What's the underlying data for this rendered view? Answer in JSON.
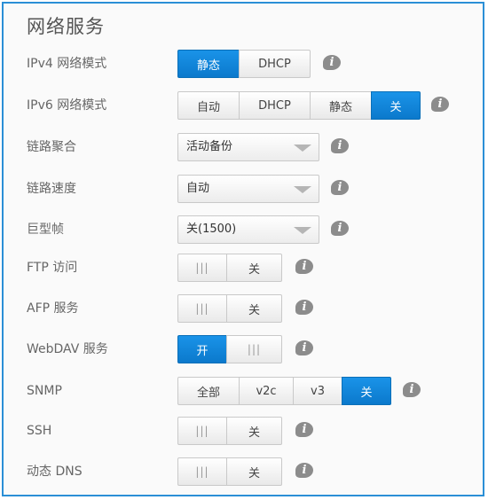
{
  "title": "网络服务",
  "info_icon_glyph": "i",
  "rows": {
    "ipv4": {
      "label": "IPv4 网络模式",
      "opt0": "静态",
      "opt1": "DHCP"
    },
    "ipv6": {
      "label": "IPv6 网络模式",
      "opt0": "自动",
      "opt1": "DHCP",
      "opt2": "静态",
      "opt3": "关"
    },
    "link_agg": {
      "label": "链路聚合",
      "value": "活动备份"
    },
    "link_speed": {
      "label": "链路速度",
      "value": "自动"
    },
    "jumbo": {
      "label": "巨型帧",
      "value": "关(1500)"
    },
    "ftp": {
      "label": "FTP 访问",
      "grip": "|||",
      "state": "关"
    },
    "afp": {
      "label": "AFP 服务",
      "grip": "|||",
      "state": "关"
    },
    "webdav": {
      "label": "WebDAV 服务",
      "state": "开",
      "grip": "|||"
    },
    "snmp": {
      "label": "SNMP",
      "opt0": "全部",
      "opt1": "v2c",
      "opt2": "v3",
      "opt3": "关"
    },
    "ssh": {
      "label": "SSH",
      "grip": "|||",
      "state": "关"
    },
    "ddns": {
      "label": "动态 DNS",
      "grip": "|||",
      "state": "关"
    }
  },
  "colors": {
    "accent": "#0b84dc",
    "border": "#2b8fd6"
  }
}
